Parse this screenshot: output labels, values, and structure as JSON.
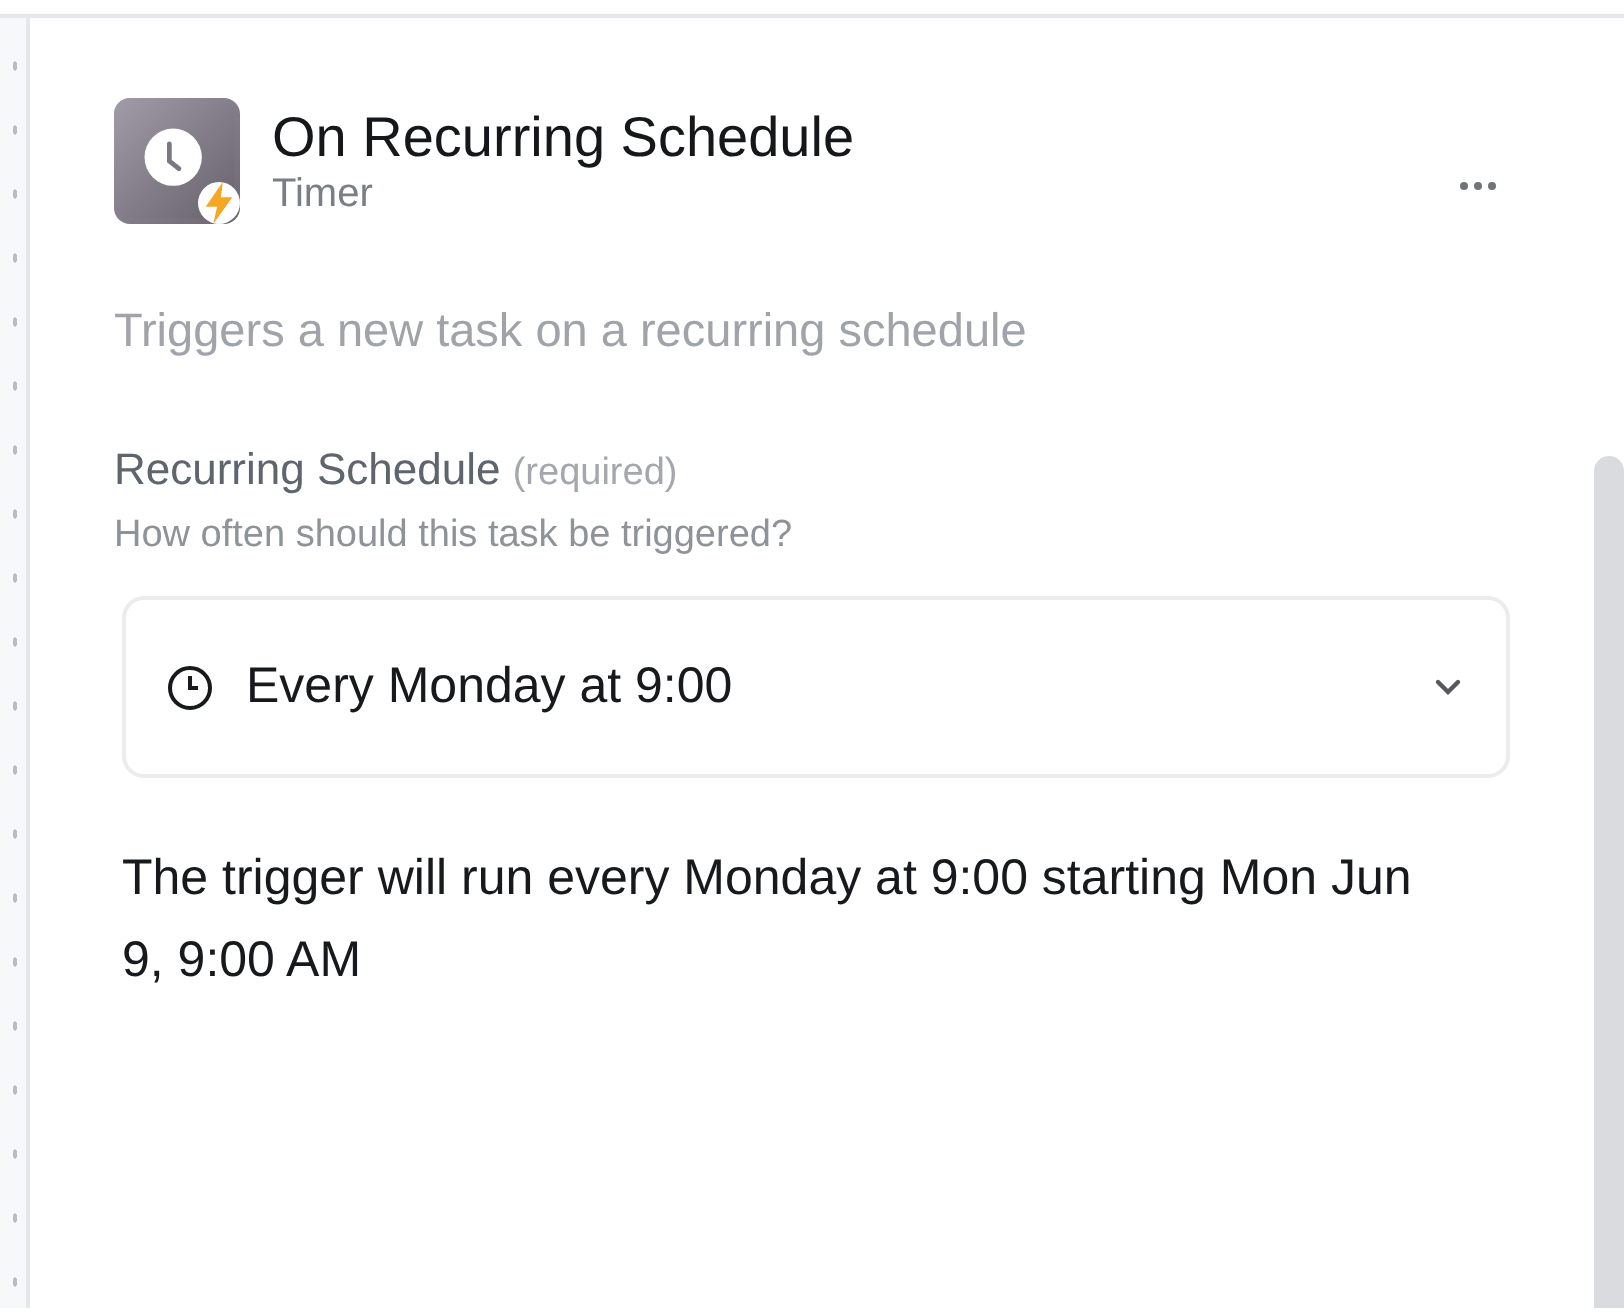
{
  "trigger": {
    "title": "On Recurring Schedule",
    "subtitle": "Timer",
    "description": "Triggers a new task on a recurring schedule"
  },
  "field": {
    "label": "Recurring Schedule",
    "required_note": "(required)",
    "hint": "How often should this task be triggered?",
    "value": "Every Monday at 9:00"
  },
  "summary": "The trigger will run every Monday at 9:00 starting Mon Jun 9, 9:00 AM"
}
